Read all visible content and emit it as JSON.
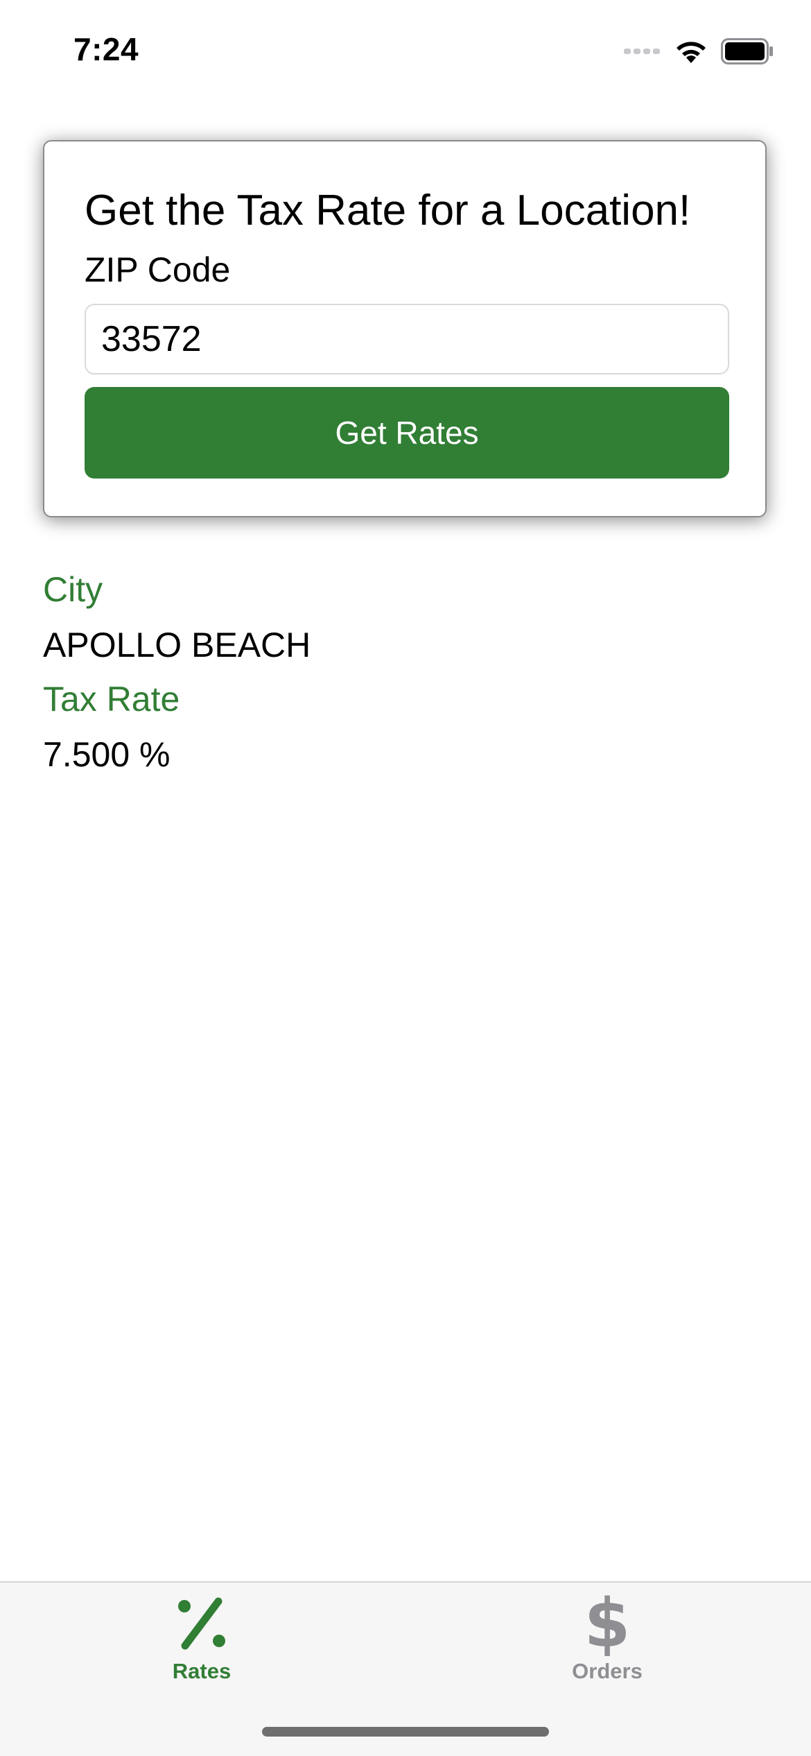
{
  "status_bar": {
    "time": "7:24"
  },
  "card": {
    "title": "Get the Tax Rate for a Location!",
    "zip_label": "ZIP Code",
    "zip_value": "33572",
    "button_label": "Get Rates"
  },
  "results": {
    "city_label": "City",
    "city_value": "APOLLO BEACH",
    "rate_label": "Tax Rate",
    "rate_value": "7.500 %"
  },
  "tabs": [
    {
      "label": "Rates",
      "icon": "percent-icon",
      "selected": true
    },
    {
      "label": "Orders",
      "icon": "dollar-icon",
      "selected": false
    }
  ],
  "colors": {
    "accent": "#317e35",
    "inactive_tab": "#8e8e93"
  }
}
